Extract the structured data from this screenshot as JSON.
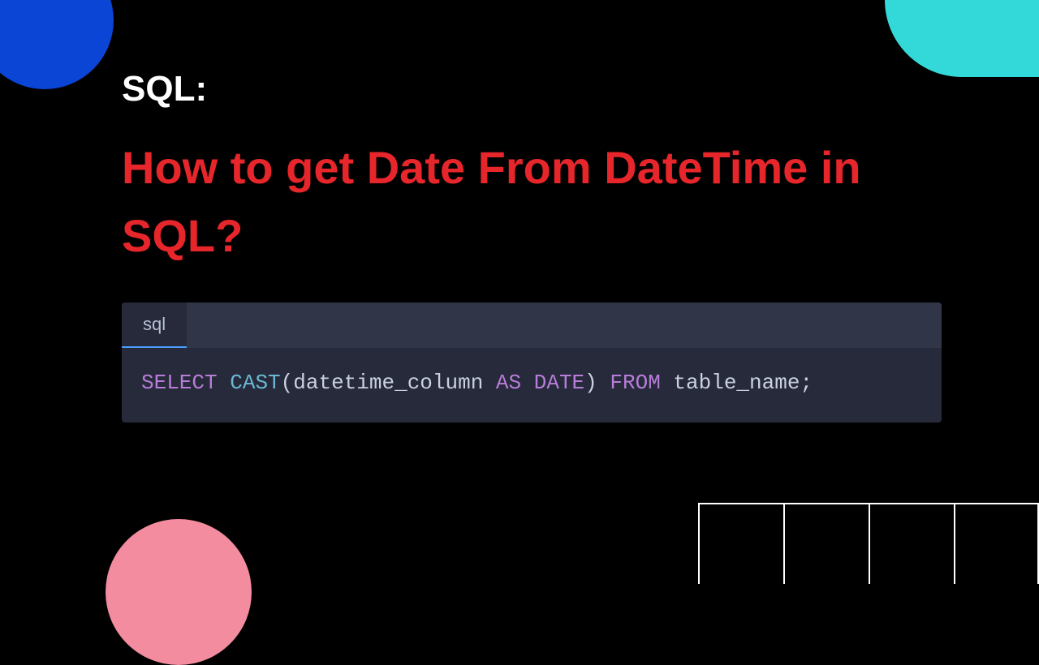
{
  "header": {
    "label": "SQL:",
    "title": "How to get Date From DateTime in SQL?"
  },
  "code": {
    "tab_label": "sql",
    "tokens": {
      "select": "SELECT",
      "cast": "CAST",
      "lparen": "(",
      "col": "datetime_column",
      "as": "AS",
      "date": "DATE",
      "rparen": ")",
      "from": "FROM",
      "table": "table_name",
      "semi": ";"
    }
  },
  "colors": {
    "bg": "#000000",
    "blue_shape": "#0a45d6",
    "cyan_shape": "#33d9d9",
    "pink_shape": "#f48ca0",
    "title_red": "#e6262b",
    "code_bg": "#262a3a",
    "kw_purple": "#b87dd9",
    "fn_blue": "#6bb8d6"
  }
}
